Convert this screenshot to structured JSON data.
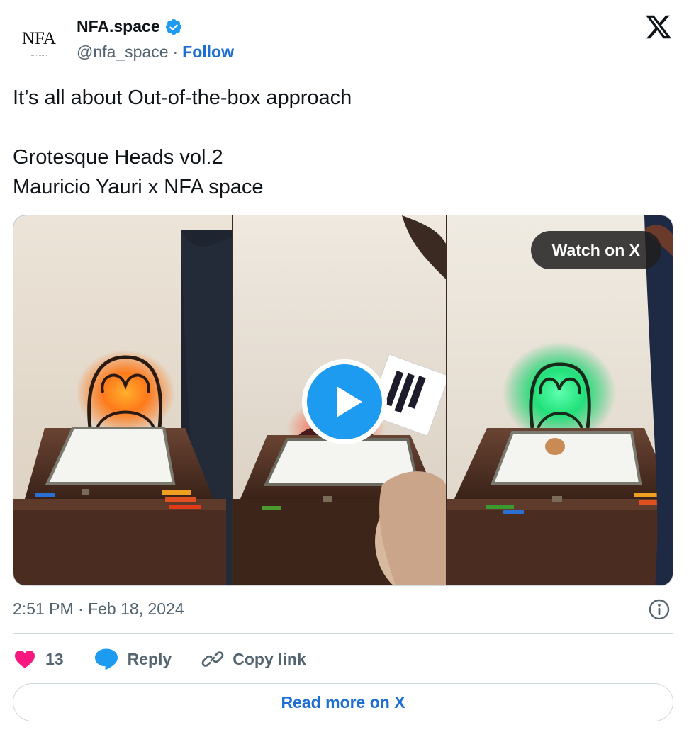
{
  "author": {
    "avatar_text": "NFA",
    "name": "NFA.space",
    "handle": "@nfa_space",
    "separator": "·",
    "follow_label": "Follow"
  },
  "tweet": {
    "text": "It’s all about Out-of-the-box approach\n\nGrotesque Heads vol.2\nMauricio Yauri x NFA space"
  },
  "media": {
    "watch_label": "Watch on X",
    "play_icon": "play-icon"
  },
  "meta": {
    "timestamp": "2:51 PM · Feb 18, 2024",
    "info_icon": "info-icon"
  },
  "actions": {
    "like_count": "13",
    "reply_label": "Reply",
    "copy_label": "Copy link"
  },
  "read_more_label": "Read more on X",
  "colors": {
    "link": "#1d6fd1",
    "verified": "#1d9bf0",
    "heart": "#f91880",
    "reply_bubble": "#1d9bf0",
    "secondary_text": "#536471"
  }
}
